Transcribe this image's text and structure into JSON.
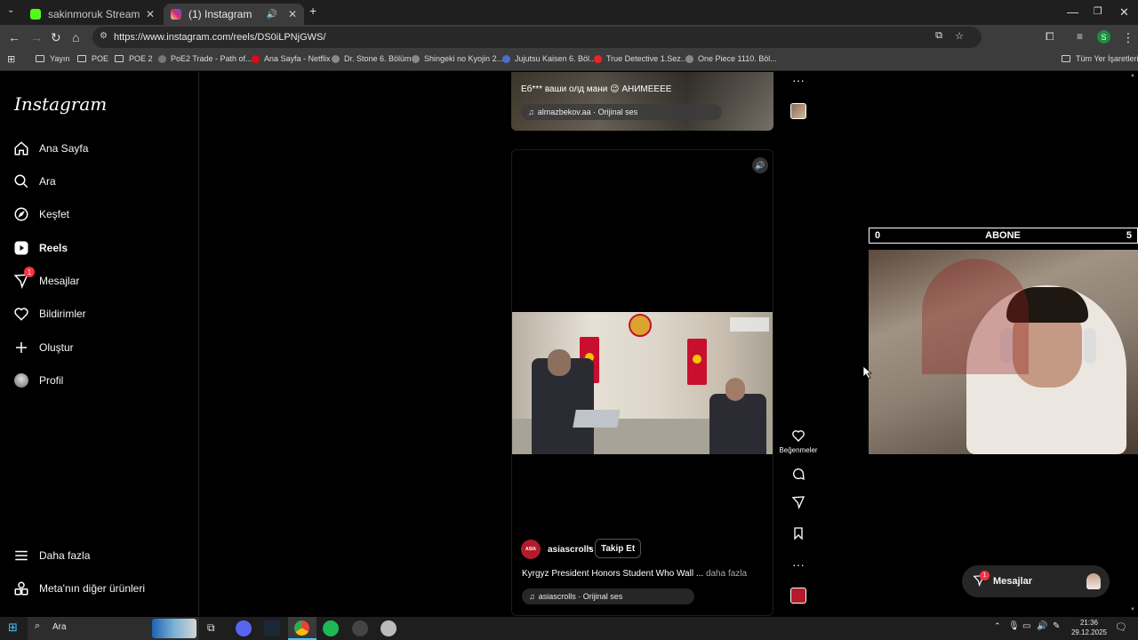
{
  "browser": {
    "tabs": [
      {
        "title": "sakinmoruk Stream - Watch Li",
        "favicon_color": "#53fc18"
      },
      {
        "title": "(1) Instagram",
        "favicon_color": "#d62976"
      }
    ],
    "url": "https://www.instagram.com/reels/DS0iLPNjGWS/",
    "bookmarks": [
      "Yayın",
      "POE",
      "POE 2",
      "PoE2 Trade - Path of...",
      "Ana Sayfa - Netflix",
      "Dr. Stone 6. Bölüm",
      "Shingeki no Kyojin 2...",
      "Jujutsu Kaisen 6. Böl...",
      "True Detective 1.Sez...",
      "One Piece 1110. Böl..."
    ],
    "all_bookmarks": "Tüm Yer İşaretleri",
    "profile_initial": "S"
  },
  "sidebar": {
    "logo": "Instagram",
    "items": [
      {
        "label": "Ana Sayfa",
        "icon": "home-icon"
      },
      {
        "label": "Ara",
        "icon": "search-icon"
      },
      {
        "label": "Keşfet",
        "icon": "explore-icon"
      },
      {
        "label": "Reels",
        "icon": "reels-icon"
      },
      {
        "label": "Mesajlar",
        "icon": "messenger-icon",
        "badge": "1"
      },
      {
        "label": "Bildirimler",
        "icon": "heart-icon"
      },
      {
        "label": "Oluştur",
        "icon": "plus-icon"
      },
      {
        "label": "Profil",
        "icon": "avatar-icon"
      }
    ],
    "more": "Daha fazla",
    "meta": "Meta'nın diğer ürünleri"
  },
  "reel_prev": {
    "caption": "Еб*** ваши олд мани 😉 АНИМЕЕЕЕ",
    "audio": "almazbekov.aa · Orijinal ses"
  },
  "reel_current": {
    "username": "asiascrolls",
    "follow": "Takip Et",
    "caption": "Kyrgyz President Honors Student Who Wall ...",
    "more": "daha fazla",
    "audio": "asiascrolls · Orijinal ses",
    "avatar_text": "ASIA",
    "likes_label": "Beğenmeler"
  },
  "stream_overlay": {
    "left": "0",
    "center": "ABONE",
    "right": "5"
  },
  "messages_pill": {
    "label": "Mesajlar",
    "badge": "1"
  },
  "taskbar": {
    "search": "Ara",
    "time": "21:36",
    "date": "29.12.2025"
  }
}
